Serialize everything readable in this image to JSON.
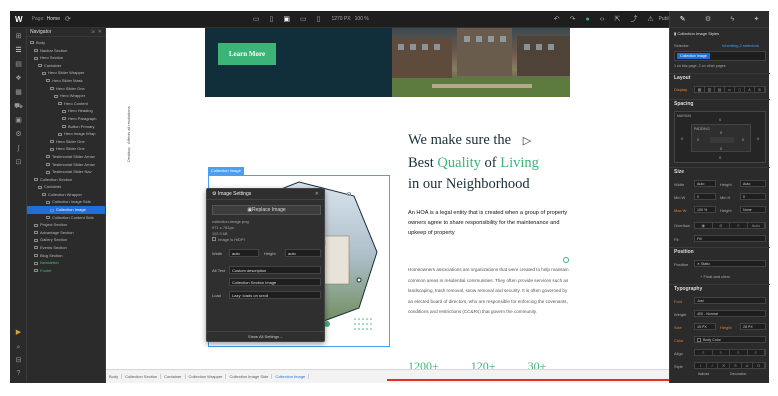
{
  "topbar": {
    "logo": "W",
    "page_label": "Page:",
    "page_name": "Home",
    "canvas_size": "1270 PX",
    "zoom": "100 %",
    "publish_label": "Publish"
  },
  "navigator": {
    "title": "Navigator",
    "items": [
      {
        "label": "Body",
        "indent": 0
      },
      {
        "label": "Navbar Section",
        "indent": 1
      },
      {
        "label": "Hero Section",
        "indent": 1
      },
      {
        "label": "Container",
        "indent": 2
      },
      {
        "label": "Hero Slider Wrapper",
        "indent": 3
      },
      {
        "label": "Hero Slider Mask",
        "indent": 4
      },
      {
        "label": "Hero Slider One",
        "indent": 5
      },
      {
        "label": "Hero Wrapper",
        "indent": 6
      },
      {
        "label": "Hero Content",
        "indent": 7
      },
      {
        "label": "Hero Heading",
        "indent": 8
      },
      {
        "label": "Hero Paragraph",
        "indent": 8
      },
      {
        "label": "Button Primary",
        "indent": 8
      },
      {
        "label": "Hero Image Wrap",
        "indent": 7
      },
      {
        "label": "Hero Slider One",
        "indent": 5
      },
      {
        "label": "Hero Slider One",
        "indent": 5
      },
      {
        "label": "Testimonial Slider Arrow",
        "indent": 4
      },
      {
        "label": "Testimonial Slider Arrow",
        "indent": 4
      },
      {
        "label": "Testimonial Slider Nav",
        "indent": 4
      },
      {
        "label": "Collection Section",
        "indent": 1
      },
      {
        "label": "Container",
        "indent": 2
      },
      {
        "label": "Collection Wrapper",
        "indent": 3
      },
      {
        "label": "Collection Image Side",
        "indent": 4
      },
      {
        "label": "Collection Image",
        "indent": 5
      },
      {
        "label": "Collection Content Side",
        "indent": 4
      },
      {
        "label": "Project Section",
        "indent": 1
      },
      {
        "label": "Advantage Section",
        "indent": 1
      },
      {
        "label": "Gallery Section",
        "indent": 1
      },
      {
        "label": "Events Section",
        "indent": 1
      },
      {
        "label": "Blog Section",
        "indent": 1
      },
      {
        "label": "Newsletter",
        "indent": 1
      },
      {
        "label": "Footer",
        "indent": 1
      }
    ]
  },
  "vertical_tabs": {
    "affects": "Affects all resolutions",
    "desktop": "Desktop"
  },
  "canvas": {
    "hero_button": "Learn More",
    "collection_label": "Collection Image",
    "heading_part1": "We make sure the",
    "heading_part2a": "Best ",
    "heading_quality": "Quality",
    "heading_of": " of ",
    "heading_living": "Living",
    "heading_part3": "in our Neighborhood",
    "para1": "An HOA is a legal entity that is created when a group of property owners agree to share responsibility for the maintenance and upkeep of property",
    "para2": "Homeowners associations are organizations that were created to help maintain common areas in residential communities. They often provide services such as landscaping, trash removal, snow removal and security. It is often governed by an elected board of directors, who are responsible for enforcing the covenants, conditions and restrictions (CC&Rs) that govern the community.",
    "stats": [
      "1200+",
      "120+",
      "30+"
    ]
  },
  "image_settings": {
    "title": "Image Settings",
    "replace_label": "Replace Image",
    "filename": "collection-image.png",
    "dims": "971 x 781px",
    "size": "112.3 kB",
    "hidpi": "Image is HiDPI",
    "width_label": "Width",
    "width_value": "auto",
    "height_label": "Height",
    "height_value": "auto",
    "alt_label": "Alt Text",
    "alt_mode": "Custom description",
    "alt_value": "Collection Section Image",
    "load_label": "Load",
    "load_value": "Lazy: loads on scroll",
    "footer": "Show All Settings"
  },
  "breadcrumbs": [
    "Body",
    "Collection Section",
    "Container",
    "Collection Wrapper",
    "Collection Image Side",
    "Collection Image"
  ],
  "right_panel": {
    "header": "Collection Image Styles",
    "selector_label": "Selector",
    "inheriting": "Inheriting 2 selectors",
    "selector_value": "Collection Image",
    "selector_note": "1 on this page, 2 on other pages",
    "layout": "Layout",
    "display_label": "Display",
    "spacing": "Spacing",
    "margin_label": "MARGIN",
    "padding_label": "PADDING",
    "zero": "0",
    "size": "Size",
    "width_label": "Width",
    "height_label": "Height",
    "min_w": "Min W",
    "min_h": "Min H",
    "max_w": "Max W",
    "max_w_value": "100",
    "pct": "%",
    "auto": "Auto",
    "none": "None",
    "overflow_label": "Overflow",
    "fit_label": "Fit",
    "fit_value": "Fill",
    "position": "Position",
    "position_label": "Position",
    "position_value": "Static",
    "float_clear": "Float and clear",
    "typography": "Typography",
    "font_label": "Font",
    "font_value": "Jost",
    "weight_label": "Weight",
    "weight_value": "400 - Normal",
    "size_label": "Size",
    "size_value": "15",
    "px": "PX",
    "height_value": "28",
    "color_label": "Color",
    "color_value": "Body Color",
    "align_label": "Align",
    "style_label": "Style",
    "italicize": "Italicize",
    "decoration": "Decoration"
  }
}
